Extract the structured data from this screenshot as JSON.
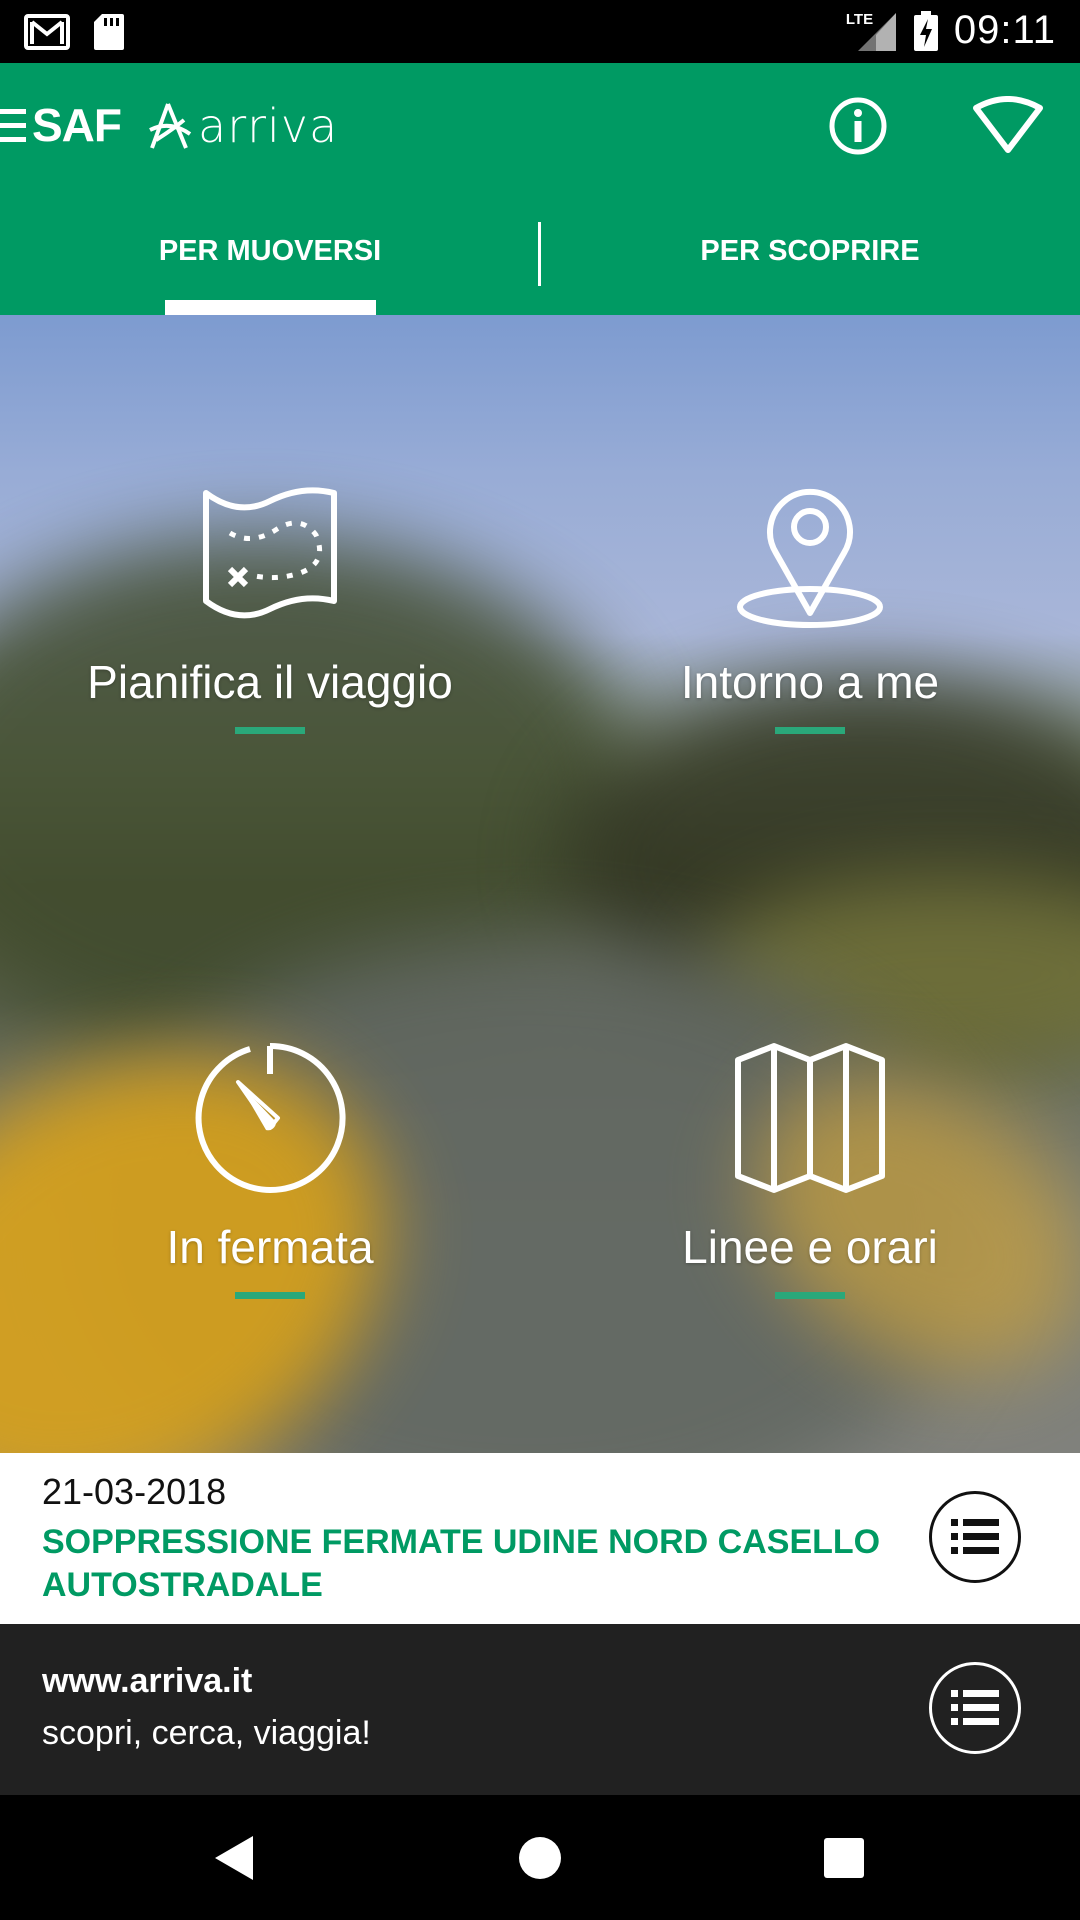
{
  "status_bar": {
    "time": "09:11",
    "network": "LTE",
    "icons": [
      "gmail-icon",
      "sd-card-icon",
      "lte-signal-icon",
      "battery-charging-icon"
    ]
  },
  "app_bar": {
    "brand": {
      "saf": "SAF",
      "arriva": "arriva"
    },
    "actions": [
      "info-icon",
      "wifi-icon"
    ],
    "tabs": [
      {
        "label": "PER MUOVERSI",
        "selected": true
      },
      {
        "label": "PER SCOPRIRE",
        "selected": false
      }
    ]
  },
  "tiles": [
    {
      "label": "Pianifica il viaggio",
      "icon": "treasure-map-icon"
    },
    {
      "label": "Intorno a me",
      "icon": "location-pin-icon"
    },
    {
      "label": "In fermata",
      "icon": "stopwatch-icon"
    },
    {
      "label": "Linee e orari",
      "icon": "folded-map-icon"
    }
  ],
  "news": {
    "date": "21-03-2018",
    "title": "SOPPRESSIONE FERMATE UDINE NORD CASELLO AUTOSTRADALE",
    "button_icon": "list-icon"
  },
  "promo": {
    "url": "www.arriva.it",
    "tagline": "scopri, cerca, viaggia!",
    "button_icon": "list-icon"
  },
  "nav_bar": [
    "back-icon",
    "home-icon",
    "recents-icon"
  ],
  "colors": {
    "brand_green": "#009a63",
    "accent_green": "#2aa87a",
    "dark": "#212121"
  }
}
